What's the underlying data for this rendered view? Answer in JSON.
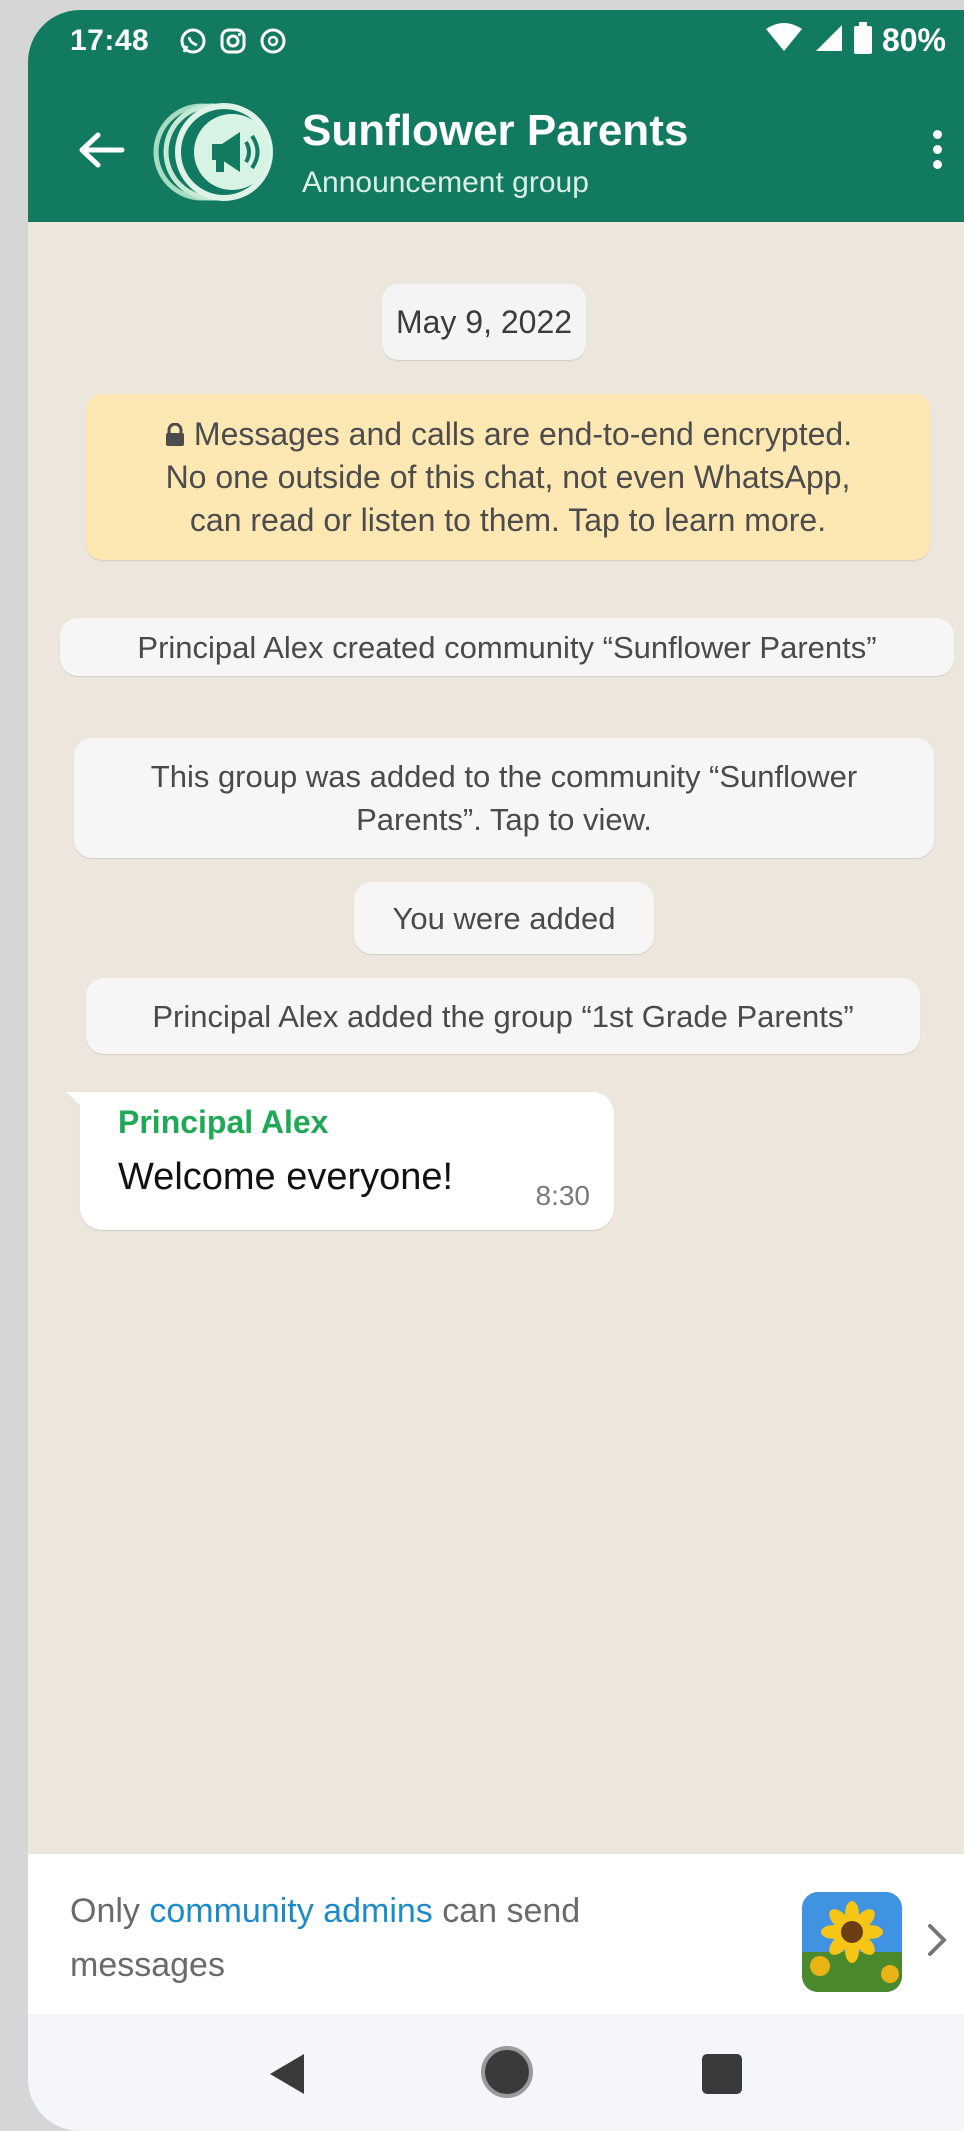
{
  "status_bar": {
    "time": "17:48",
    "battery": "80%",
    "icons": [
      "whatsapp-icon",
      "instagram-icon",
      "threads-icon",
      "wifi-icon",
      "signal-icon",
      "battery-icon"
    ]
  },
  "header": {
    "title": "Sunflower Parents",
    "subtitle": "Announcement group",
    "color": "#137a62"
  },
  "chat": {
    "date": "May 9, 2022",
    "encryption_lines": [
      "Messages and calls are end-to-end encrypted.",
      "No one outside of this chat, not even WhatsApp,",
      "can read or listen to them. Tap to learn more."
    ],
    "system_messages": [
      {
        "lines": [
          "Principal Alex created community “Sunflower Parents”"
        ]
      },
      {
        "lines": [
          "This group was added to the community “Sunflower",
          "Parents”. Tap to view."
        ]
      },
      {
        "lines": [
          "You were added"
        ]
      },
      {
        "lines": [
          "Principal Alex added the group “1st Grade Parents”"
        ]
      }
    ],
    "message": {
      "sender": "Principal Alex",
      "text": "Welcome everyone!",
      "time": "8:30",
      "sender_color": "#1fa855"
    }
  },
  "footer": {
    "note_prefix": "Only ",
    "note_link": "community admins",
    "note_suffix": " can send messages",
    "link_color": "#1c8bc9"
  },
  "nav": {
    "icons": [
      "back-triangle-icon",
      "home-circle-icon",
      "recents-square-icon"
    ]
  }
}
